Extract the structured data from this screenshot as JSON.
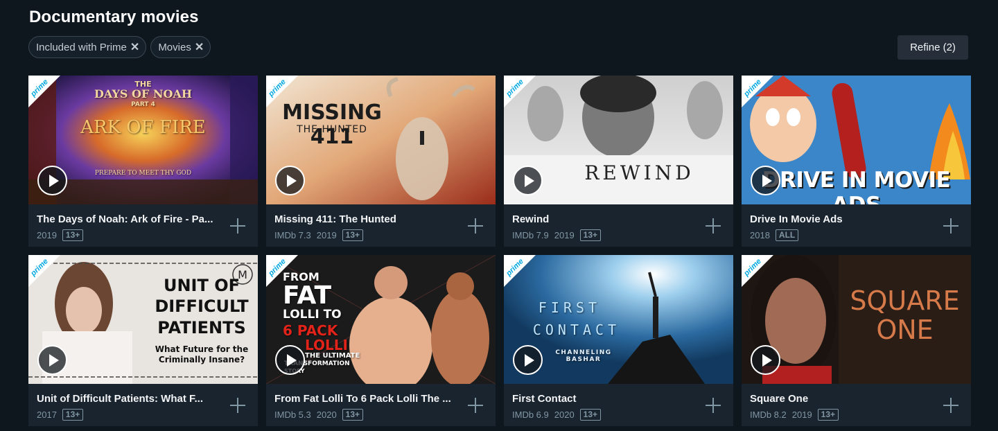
{
  "page": {
    "title": "Documentary movies"
  },
  "filters": [
    {
      "label": "Included with Prime"
    },
    {
      "label": "Movies"
    }
  ],
  "refine": {
    "label": "Refine (2)"
  },
  "prime_badge": "prime",
  "movies": [
    {
      "title": "The Days of Noah: Ark of Fire - Pa...",
      "imdb": "",
      "year": "2019",
      "rating": "13+",
      "art": [
        "THE",
        "DAYS OF NOAH",
        "PART 4",
        "ARK OF FIRE",
        "PREPARE TO MEET THY GOD"
      ]
    },
    {
      "title": "Missing 411: The Hunted",
      "imdb": "IMDb 7.3",
      "year": "2019",
      "rating": "13+",
      "art": [
        "MISSING 411",
        "THE HUNTED"
      ]
    },
    {
      "title": "Rewind",
      "imdb": "IMDb 7.9",
      "year": "2019",
      "rating": "13+",
      "art": [
        "REWIND"
      ]
    },
    {
      "title": "Drive In Movie Ads",
      "imdb": "",
      "year": "2018",
      "rating": "ALL",
      "art": [
        "DRIVE IN MOVIE ADS"
      ]
    },
    {
      "title": "Unit of Difficult Patients: What F...",
      "imdb": "",
      "year": "2017",
      "rating": "13+",
      "art": [
        "UNIT OF",
        "DIFFICULT",
        "PATIENTS",
        "What Future for the",
        "Criminally Insane?",
        "M"
      ]
    },
    {
      "title": "From Fat Lolli To 6 Pack Lolli The ...",
      "imdb": "IMDb 5.3",
      "year": "2020",
      "rating": "13+",
      "art": [
        "FROM",
        "FAT",
        "LOLLI TO",
        "6 PACK",
        "LOLLI",
        "THE ULTIMATE",
        "TRANSFORMATION",
        "STORY"
      ]
    },
    {
      "title": "First Contact",
      "imdb": "IMDb 6.9",
      "year": "2020",
      "rating": "13+",
      "art": [
        "FIRST",
        "CONTACT",
        "CHANNELING BASHAR"
      ]
    },
    {
      "title": "Square One",
      "imdb": "IMDb 8.2",
      "year": "2019",
      "rating": "13+",
      "art": [
        "SQUARE",
        "ONE"
      ]
    }
  ],
  "colors": {
    "background": "#0f171e",
    "card": "#1a242f",
    "prime_blue": "#00a8e1",
    "meta_text": "#8197a4"
  }
}
